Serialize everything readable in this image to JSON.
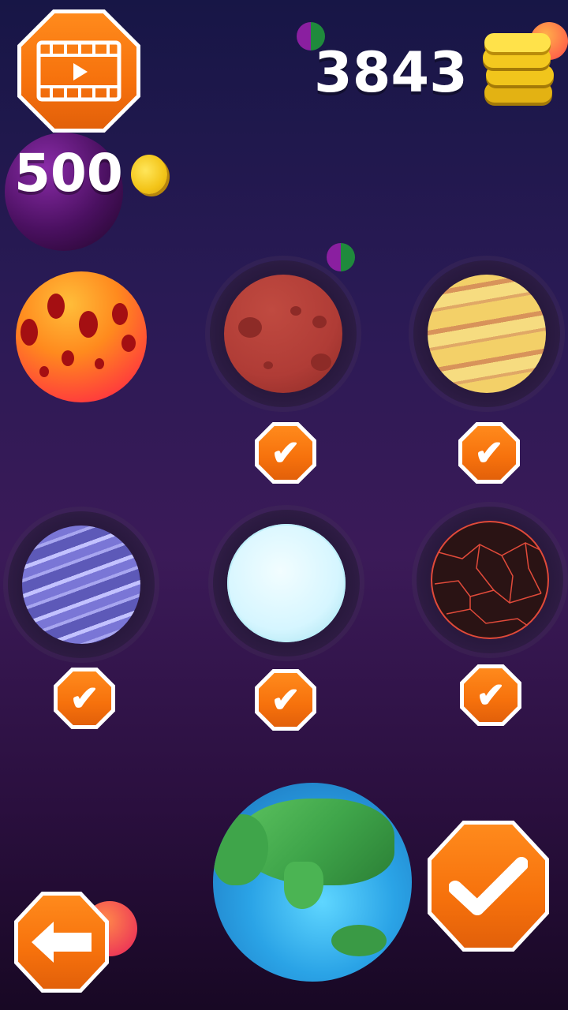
{
  "hud": {
    "coin_total": "3843",
    "video_reward": "500",
    "video_icon": "film-play-icon",
    "coin_icon": "gold-coin-icon"
  },
  "planets": [
    {
      "id": "lava-crater",
      "status": "selected",
      "colors": [
        "#ff9a1e",
        "#ff3c3c",
        "#a40f12"
      ]
    },
    {
      "id": "red-mars",
      "status": "owned",
      "check_icon": "checkmark-icon",
      "colors": [
        "#b8413a",
        "#8d2b27"
      ]
    },
    {
      "id": "yellow-gas",
      "status": "owned",
      "check_icon": "checkmark-icon",
      "colors": [
        "#f3d068",
        "#d8935a"
      ]
    },
    {
      "id": "purple-striped",
      "status": "owned",
      "check_icon": "checkmark-icon",
      "colors": [
        "#6a66c6",
        "#c3c2ff"
      ]
    },
    {
      "id": "ice",
      "status": "owned",
      "check_icon": "checkmark-icon",
      "colors": [
        "#d6f6ff",
        "#9fdfee"
      ]
    },
    {
      "id": "dark-lava",
      "status": "owned",
      "check_icon": "checkmark-icon",
      "colors": [
        "#2a1314",
        "#e14a3a"
      ]
    }
  ],
  "preview": {
    "planet": "earth-lowpoly",
    "colors": [
      "#2aa3e6",
      "#3fa54a"
    ]
  },
  "buttons": {
    "back_icon": "arrow-left-icon",
    "confirm_icon": "checkmark-icon"
  },
  "accent": "#f6710c"
}
